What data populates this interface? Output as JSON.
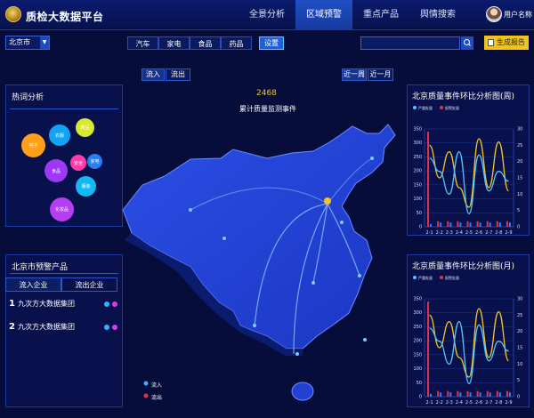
{
  "header": {
    "app_title": "质检大数据平台",
    "nav": [
      "全景分析",
      "区域预警",
      "重点产品",
      "舆情搜索"
    ],
    "active_nav": 1,
    "username": "用户名称"
  },
  "toolbar": {
    "city": "北京市",
    "categories": [
      "汽车",
      "家电",
      "食品",
      "药品"
    ],
    "settings_label": "设置",
    "search_placeholder": "",
    "report_label": "生成报告"
  },
  "hot_analysis": {
    "title": "热词分析",
    "bubbles": [
      {
        "label": "电子",
        "color": "#ff9f1a"
      },
      {
        "label": "衣服",
        "color": "#12a3f2"
      },
      {
        "label": "药品",
        "color": "#d7ea33"
      },
      {
        "label": "家电",
        "color": "#2a7ef4"
      },
      {
        "label": "安全",
        "color": "#ff3ca8"
      },
      {
        "label": "食品",
        "color": "#9d38f4"
      },
      {
        "label": "服装",
        "color": "#14b8f2"
      },
      {
        "label": "化妆品",
        "color": "#b53df2"
      }
    ]
  },
  "warning_products": {
    "title": "北京市预警产品",
    "tabs": [
      "流入企业",
      "流出企业"
    ],
    "rows": [
      {
        "num": "1",
        "name": "九次方大数据集团"
      },
      {
        "num": "2",
        "name": "九次方大数据集团"
      }
    ]
  },
  "map": {
    "flow_in_label": "流入",
    "flow_out_label": "流出",
    "period_week": "近一周",
    "period_month": "近一月",
    "metric_value": "2468",
    "metric_label": "累计质量监测事件",
    "legend_in": "流入",
    "legend_out": "流出"
  },
  "charts": {
    "week_title": "北京质量事件环比分析图(周)",
    "month_title": "北京质量事件环比分析图(月)",
    "legend": [
      "严重批量",
      "报警批量"
    ],
    "colors": {
      "bar1": "#e0344e",
      "bar2": "#3f7cf4",
      "line1": "#f2c41b",
      "line2": "#53c3ff"
    }
  },
  "chart_data": [
    {
      "type": "bar",
      "title": "北京质量事件环比分析图(周)",
      "categories": [
        "2-1",
        "2-2",
        "2-3",
        "2-4",
        "2-5",
        "2-6",
        "2-7",
        "2-8",
        "2-9"
      ],
      "series": [
        {
          "name": "严重批量",
          "values": [
            340,
            20,
            20,
            20,
            20,
            20,
            20,
            20,
            20
          ]
        },
        {
          "name": "报警批量",
          "values": [
            10,
            15,
            15,
            15,
            15,
            15,
            15,
            15,
            15
          ]
        }
      ],
      "lines": [
        {
          "values": [
            25,
            15,
            23,
            12,
            6,
            27,
            12,
            26,
            11
          ]
        },
        {
          "values": [
            21,
            17,
            10,
            23,
            4,
            22,
            11,
            17,
            14
          ]
        }
      ],
      "ylim_left": [
        0,
        350
      ],
      "ylim_right": [
        0,
        30
      ],
      "yticks_left": [
        0,
        50,
        100,
        150,
        200,
        250,
        300,
        350
      ],
      "yticks_right": [
        0,
        5,
        10,
        15,
        20,
        25,
        30
      ]
    },
    {
      "type": "bar",
      "title": "北京质量事件环比分析图(月)",
      "categories": [
        "2-1",
        "2-2",
        "2-3",
        "2-4",
        "2-5",
        "2-6",
        "2-7",
        "2-8",
        "2-9"
      ],
      "series": [
        {
          "name": "严重批量",
          "values": [
            340,
            20,
            20,
            20,
            20,
            20,
            20,
            20,
            20
          ]
        },
        {
          "name": "报警批量",
          "values": [
            10,
            15,
            15,
            15,
            15,
            15,
            15,
            15,
            15
          ]
        }
      ],
      "lines": [
        {
          "values": [
            25,
            15,
            23,
            12,
            6,
            27,
            12,
            26,
            11
          ]
        },
        {
          "values": [
            21,
            17,
            10,
            23,
            4,
            22,
            11,
            17,
            14
          ]
        }
      ],
      "ylim_left": [
        0,
        350
      ],
      "ylim_right": [
        0,
        30
      ],
      "yticks_left": [
        0,
        50,
        100,
        150,
        200,
        250,
        300,
        350
      ],
      "yticks_right": [
        0,
        5,
        10,
        15,
        20,
        25,
        30
      ]
    }
  ]
}
